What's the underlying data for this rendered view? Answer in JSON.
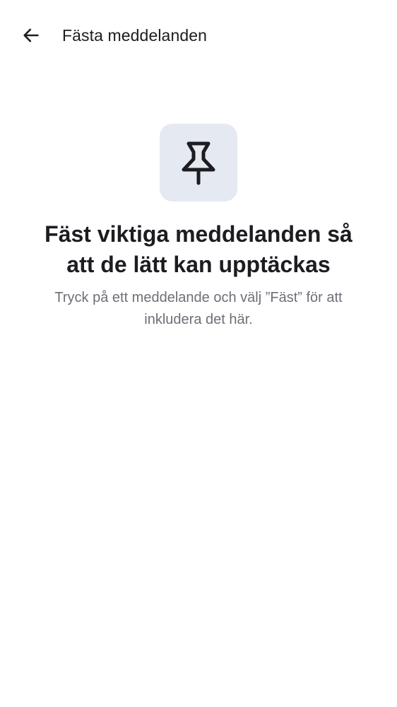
{
  "header": {
    "back_icon": "arrow-left-icon",
    "title": "Fästa meddelanden"
  },
  "empty_state": {
    "icon": "pushpin-icon",
    "icon_tile_color": "#e5e9f2",
    "heading": "Fäst viktiga meddelanden så att de lätt kan upptäckas",
    "body": "Tryck på ett meddelande och välj ”Fäst” för att inkludera det här."
  }
}
